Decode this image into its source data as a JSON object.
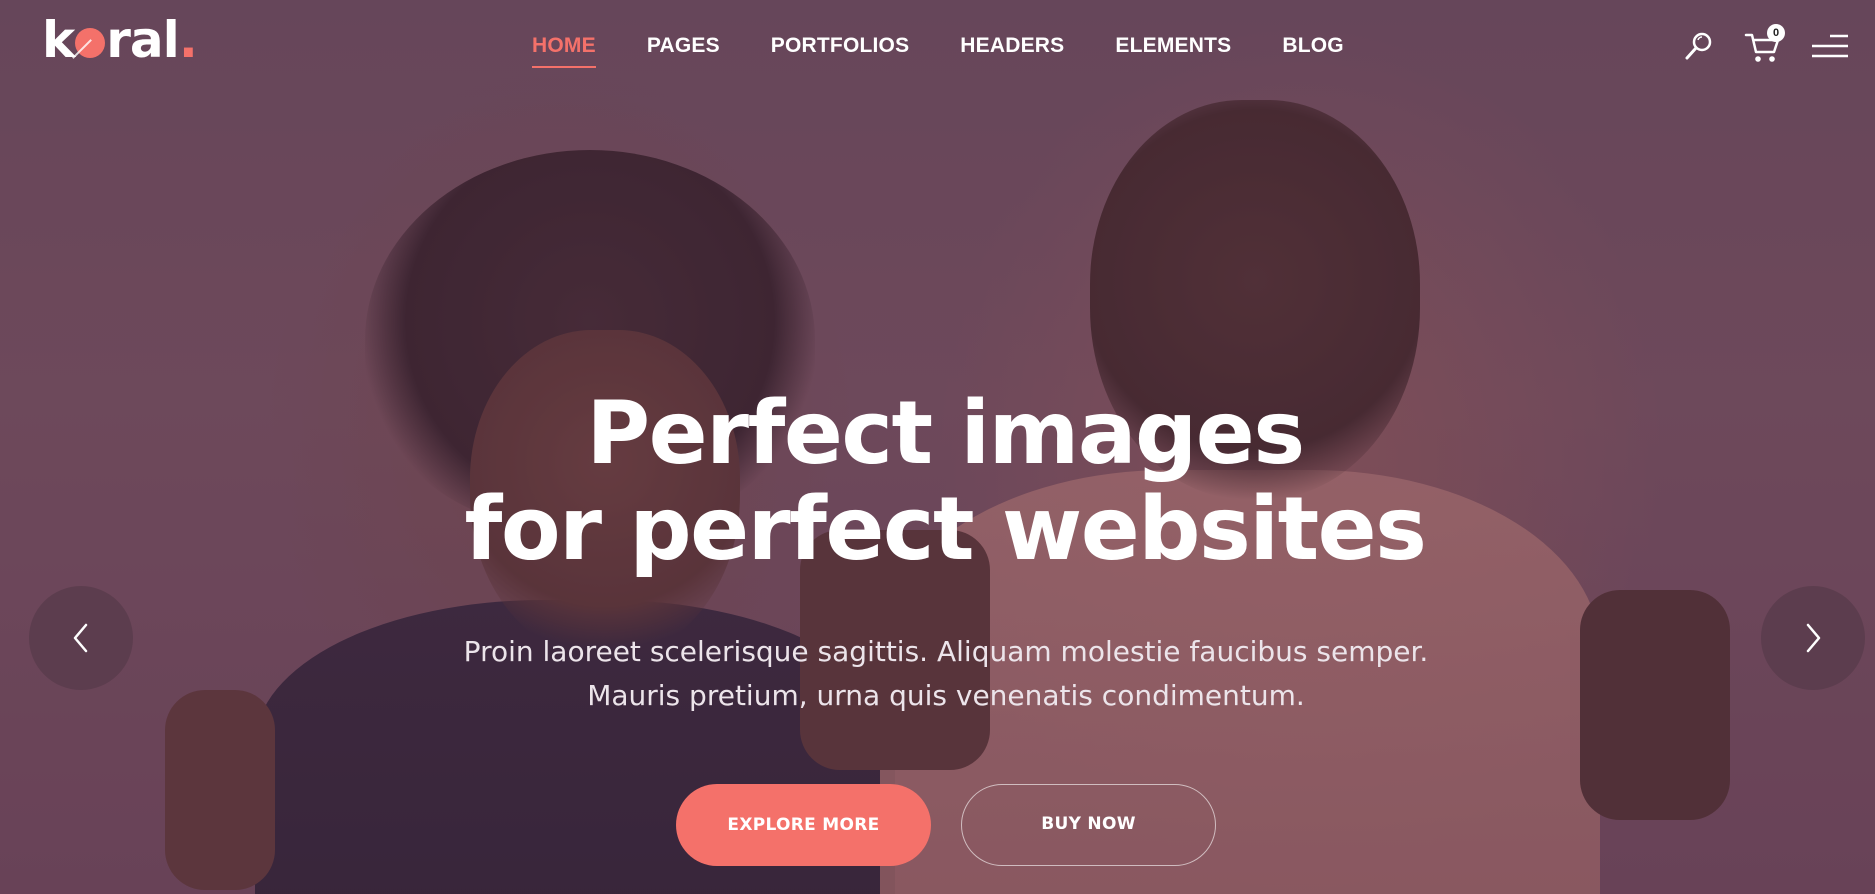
{
  "brand": {
    "logo_k": "k",
    "logo_rest": "ral",
    "logo_dot": ".",
    "accent_color": "#f4716a"
  },
  "nav": {
    "items": [
      {
        "label": "HOME",
        "active": true
      },
      {
        "label": "PAGES",
        "active": false
      },
      {
        "label": "PORTFOLIOS",
        "active": false
      },
      {
        "label": "HEADERS",
        "active": false
      },
      {
        "label": "ELEMENTS",
        "active": false
      },
      {
        "label": "BLOG",
        "active": false
      }
    ]
  },
  "header_icons": {
    "search": "search-icon",
    "cart": "cart-icon",
    "cart_count": "0",
    "menu": "menu-icon"
  },
  "hero": {
    "headline_line1": "Perfect images",
    "headline_line2": "for perfect websites",
    "subtext_line1": "Proin laoreet scelerisque sagittis. Aliquam molestie faucibus semper.",
    "subtext_line2": "Mauris pretium, urna quis venenatis condimentum.",
    "primary_button": "EXPLORE MORE",
    "secondary_button": "BUY NOW",
    "prev_icon": "chevron-left-icon",
    "next_icon": "chevron-right-icon"
  }
}
